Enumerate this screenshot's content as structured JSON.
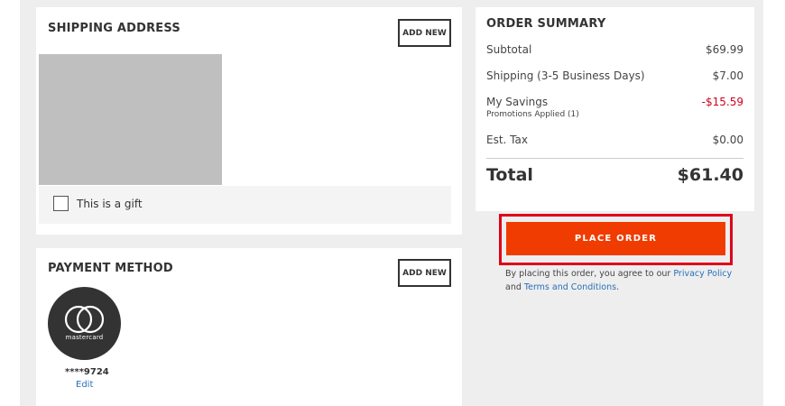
{
  "shipping": {
    "title": "SHIPPING ADDRESS",
    "add_new_label": "ADD NEW",
    "gift_label": "This is a gift"
  },
  "payment": {
    "title": "PAYMENT METHOD",
    "add_new_label": "ADD NEW",
    "card_brand": "mastercard",
    "card_number": "****9724",
    "edit_label": "Edit"
  },
  "summary": {
    "title": "ORDER SUMMARY",
    "subtotal_label": "Subtotal",
    "subtotal_value": "$69.99",
    "shipping_label": "Shipping (3-5 Business Days)",
    "shipping_value": "$7.00",
    "savings_label": "My Savings",
    "savings_value": "-$15.59",
    "promotions_label": "Promotions Applied (1)",
    "tax_label": "Est. Tax",
    "tax_value": "$0.00",
    "total_label": "Total",
    "total_value": "$61.40"
  },
  "place_order": {
    "label": "PLACE ORDER"
  },
  "terms": {
    "prefix": "By placing this order, you agree to our",
    "privacy_link": "Privacy Policy",
    "and_text": "and",
    "conditions_link": "Terms and Conditions",
    "suffix": "."
  },
  "colors": {
    "page_background": "#eeeeee",
    "card_background": "#ffffff",
    "accent_orange": "#f03c00",
    "highlight_red": "#e0001a",
    "savings_red": "#d0021b",
    "link_blue": "#2a6ebb"
  },
  "icons": {
    "card_logo": "mastercard-icon"
  }
}
